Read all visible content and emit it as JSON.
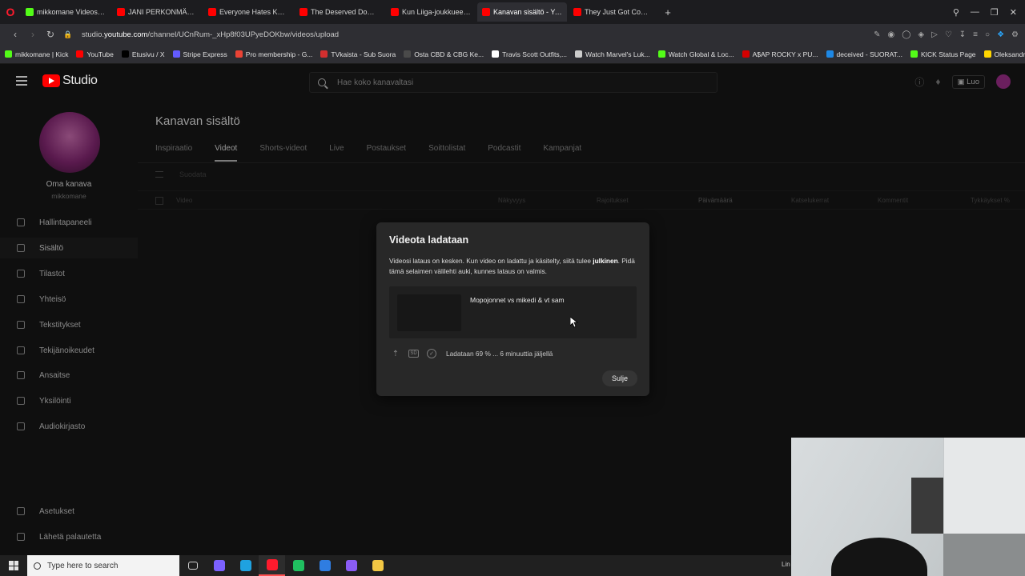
{
  "browser": {
    "tabs": [
      {
        "label": "mikkomane Videos - Wat",
        "color": "#53fc18",
        "active": false
      },
      {
        "label": "JANI PERKONMÄKI: Ex-pu",
        "color": "#ff0000",
        "active": false
      },
      {
        "label": "Everyone Hates Kai Cenat",
        "color": "#ff0000",
        "active": false
      },
      {
        "label": "The Deserved Downfall of",
        "color": "#ff0000",
        "active": false
      },
      {
        "label": "Kun Liiga-joukkueen pelk",
        "color": "#ff0000",
        "active": false
      },
      {
        "label": "Kanavan sisältö - YouTub",
        "color": "#ff0000",
        "active": true
      },
      {
        "label": "They Just Got Completely",
        "color": "#ff0000",
        "active": false
      }
    ],
    "url_prefix": "studio.",
    "url_host": "youtube.com",
    "url_path": "/channel/UCnRum-_xHp8f03UPyeDOKbw/videos/upload",
    "bookmarks": [
      {
        "label": "mikkomane | Kick",
        "color": "#53fc18"
      },
      {
        "label": "YouTube",
        "color": "#ff0000"
      },
      {
        "label": "Etusivu / X",
        "color": "#000000"
      },
      {
        "label": "Stripe Express",
        "color": "#635bff"
      },
      {
        "label": "Pro membership - G...",
        "color": "#ea4335"
      },
      {
        "label": "TVkaista - Sub Suora",
        "color": "#d32f2f"
      },
      {
        "label": "Osta CBD & CBG Ke...",
        "color": "#4a4a4a"
      },
      {
        "label": "Travis Scott Outfits,...",
        "color": "#ffffff"
      },
      {
        "label": "Watch Marvel's Luk...",
        "color": "#cccccc"
      },
      {
        "label": "Watch Global & Loc...",
        "color": "#53fc18"
      },
      {
        "label": "A$AP ROCKY x PU...",
        "color": "#d50000"
      },
      {
        "label": "deceived - SUORAT...",
        "color": "#1e88e5"
      },
      {
        "label": "KICK Status Page",
        "color": "#53fc18"
      },
      {
        "label": "Oleksandr Usyk vs D...",
        "color": "#ffd600"
      }
    ]
  },
  "studio": {
    "logo_text": "Studio",
    "search_placeholder": "Hae koko kanavaltasi",
    "create_label": "Luo",
    "channel": {
      "name": "Oma kanava",
      "handle": "mikkomane"
    },
    "nav": [
      {
        "label": "Hallintapaneeli",
        "active": false
      },
      {
        "label": "Sisältö",
        "active": true
      },
      {
        "label": "Tilastot",
        "active": false
      },
      {
        "label": "Yhteisö",
        "active": false
      },
      {
        "label": "Tekstitykset",
        "active": false
      },
      {
        "label": "Tekijänoikeudet",
        "active": false
      },
      {
        "label": "Ansaitse",
        "active": false
      },
      {
        "label": "Yksilöinti",
        "active": false
      },
      {
        "label": "Audiokirjasto",
        "active": false
      }
    ],
    "bottom_nav": [
      {
        "label": "Asetukset"
      },
      {
        "label": "Lähetä palautetta"
      }
    ],
    "page_title": "Kanavan sisältö",
    "content_tabs": [
      {
        "label": "Inspiraatio",
        "active": false
      },
      {
        "label": "Videot",
        "active": true
      },
      {
        "label": "Shorts-videot",
        "active": false
      },
      {
        "label": "Live",
        "active": false
      },
      {
        "label": "Postaukset",
        "active": false
      },
      {
        "label": "Soittolistat",
        "active": false
      },
      {
        "label": "Podcastit",
        "active": false
      },
      {
        "label": "Kampanjat",
        "active": false
      }
    ],
    "filter_placeholder": "Suodata",
    "table_columns": [
      "Video",
      "Näkyvyys",
      "Rajoitukset",
      "Päivämäärä",
      "Katselukerrat",
      "Kommentit",
      "Tykkäykset %"
    ]
  },
  "dialog": {
    "title": "Videota ladataan",
    "desc_before": "Videosi lataus on kesken. Kun video on ladattu ja käsitelty, siitä tulee ",
    "desc_bold": "julkinen",
    "desc_after": ". Pidä tämä selaimen välilehti auki, kunnes lataus on valmis.",
    "video_title": "Mopojonnet vs mikedi & vt sam",
    "sd_badge": "SD",
    "status": "Ladataan 69 % ... 6 minuuttia jäljellä",
    "progress_percent": 69,
    "close_label": "Sulje"
  },
  "taskbar": {
    "search_placeholder": "Type here to search",
    "right_text": "Lin",
    "apps": [
      {
        "name": "task-view",
        "color": "#cfcfcf",
        "active": false
      },
      {
        "name": "copilot",
        "color": "#7b61ff",
        "active": false
      },
      {
        "name": "edge",
        "color": "#1fa2e0",
        "active": false
      },
      {
        "name": "opera",
        "color": "#ff1b2d",
        "active": true
      },
      {
        "name": "app-green",
        "color": "#20c060",
        "active": false
      },
      {
        "name": "app-blue",
        "color": "#2f7de1",
        "active": false
      },
      {
        "name": "app-purple",
        "color": "#8a5cf6",
        "active": false
      },
      {
        "name": "file-explorer",
        "color": "#f2c744",
        "active": false
      }
    ]
  },
  "colors": {
    "youtube_red": "#ff0000",
    "dialog_bg": "#282828",
    "app_bg": "#0f0f0f"
  }
}
